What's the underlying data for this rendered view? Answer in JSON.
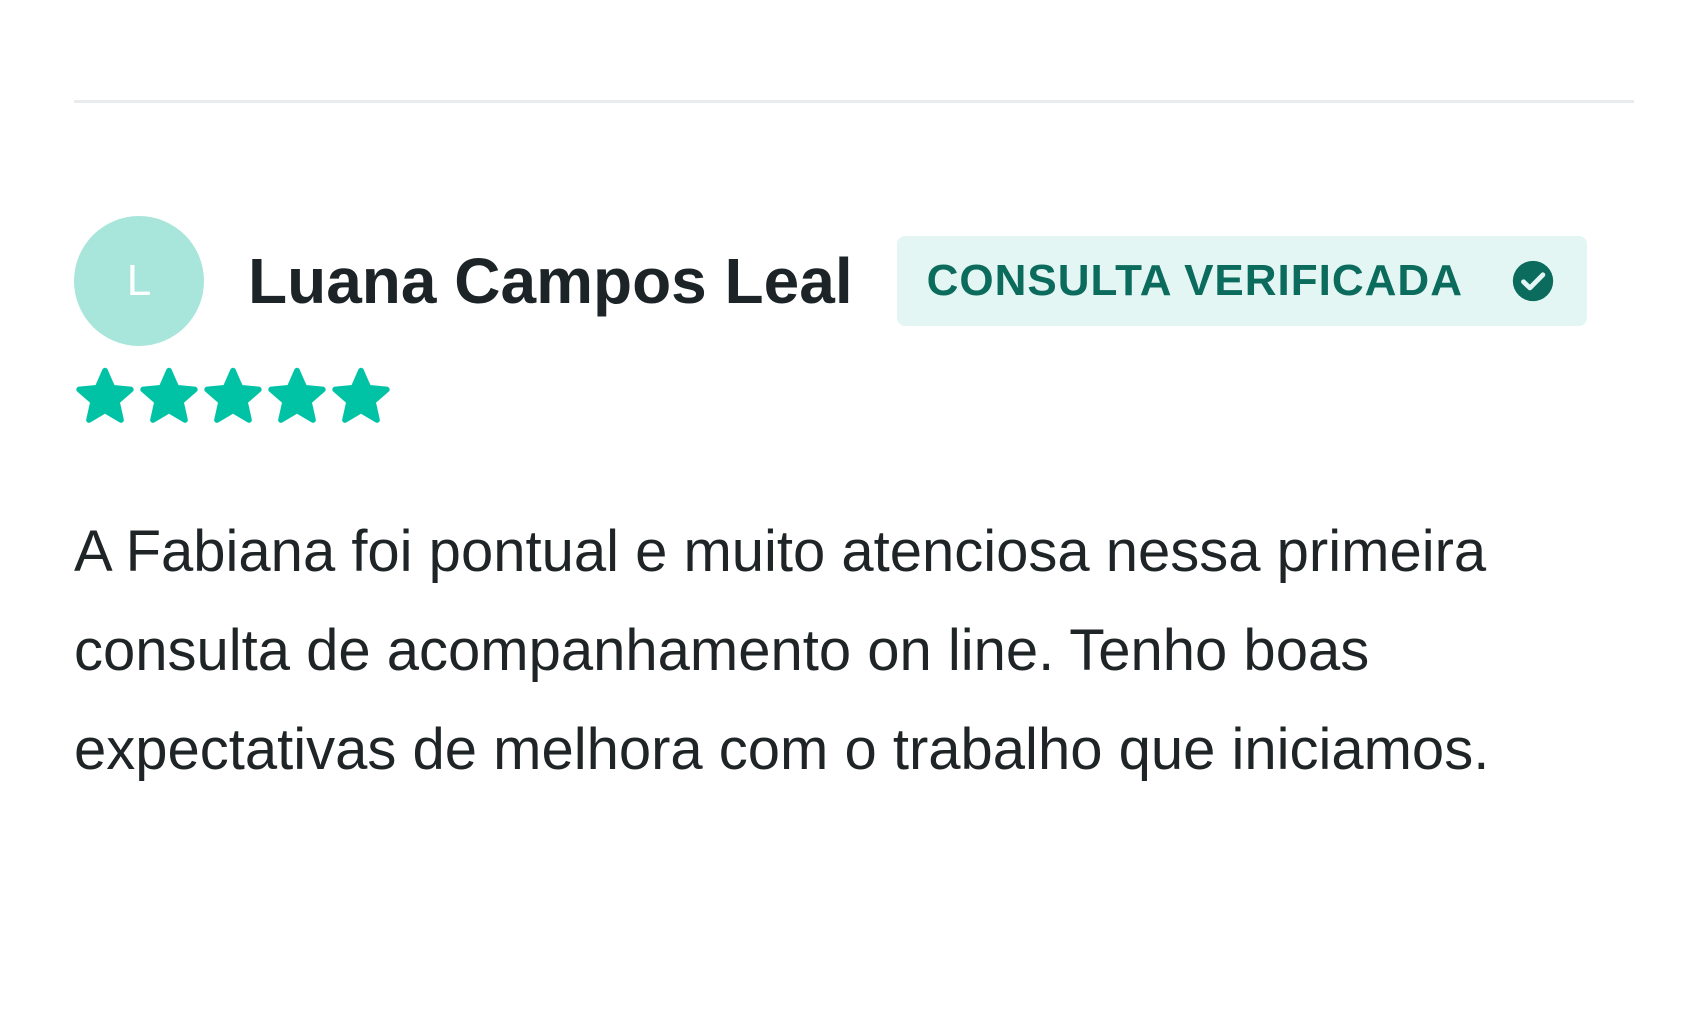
{
  "review": {
    "avatar_initial": "L",
    "reviewer_name": "Luana Campos Leal",
    "badge_label": "CONSULTA VERIFICADA",
    "badge_icon": "check-circle-icon",
    "rating": 5,
    "rating_max": 5,
    "text": "A Fabiana foi pontual e muito atenciosa nessa primeira consulta de acompanhamento on line. Tenho boas expectativas de melhora com o trabalho que iniciamos."
  },
  "colors": {
    "accent": "#00c3a5",
    "avatar_bg": "#a8e6db",
    "badge_bg": "#e3f6f3",
    "badge_text": "#0b6b5c",
    "divider": "#e9ecee"
  }
}
